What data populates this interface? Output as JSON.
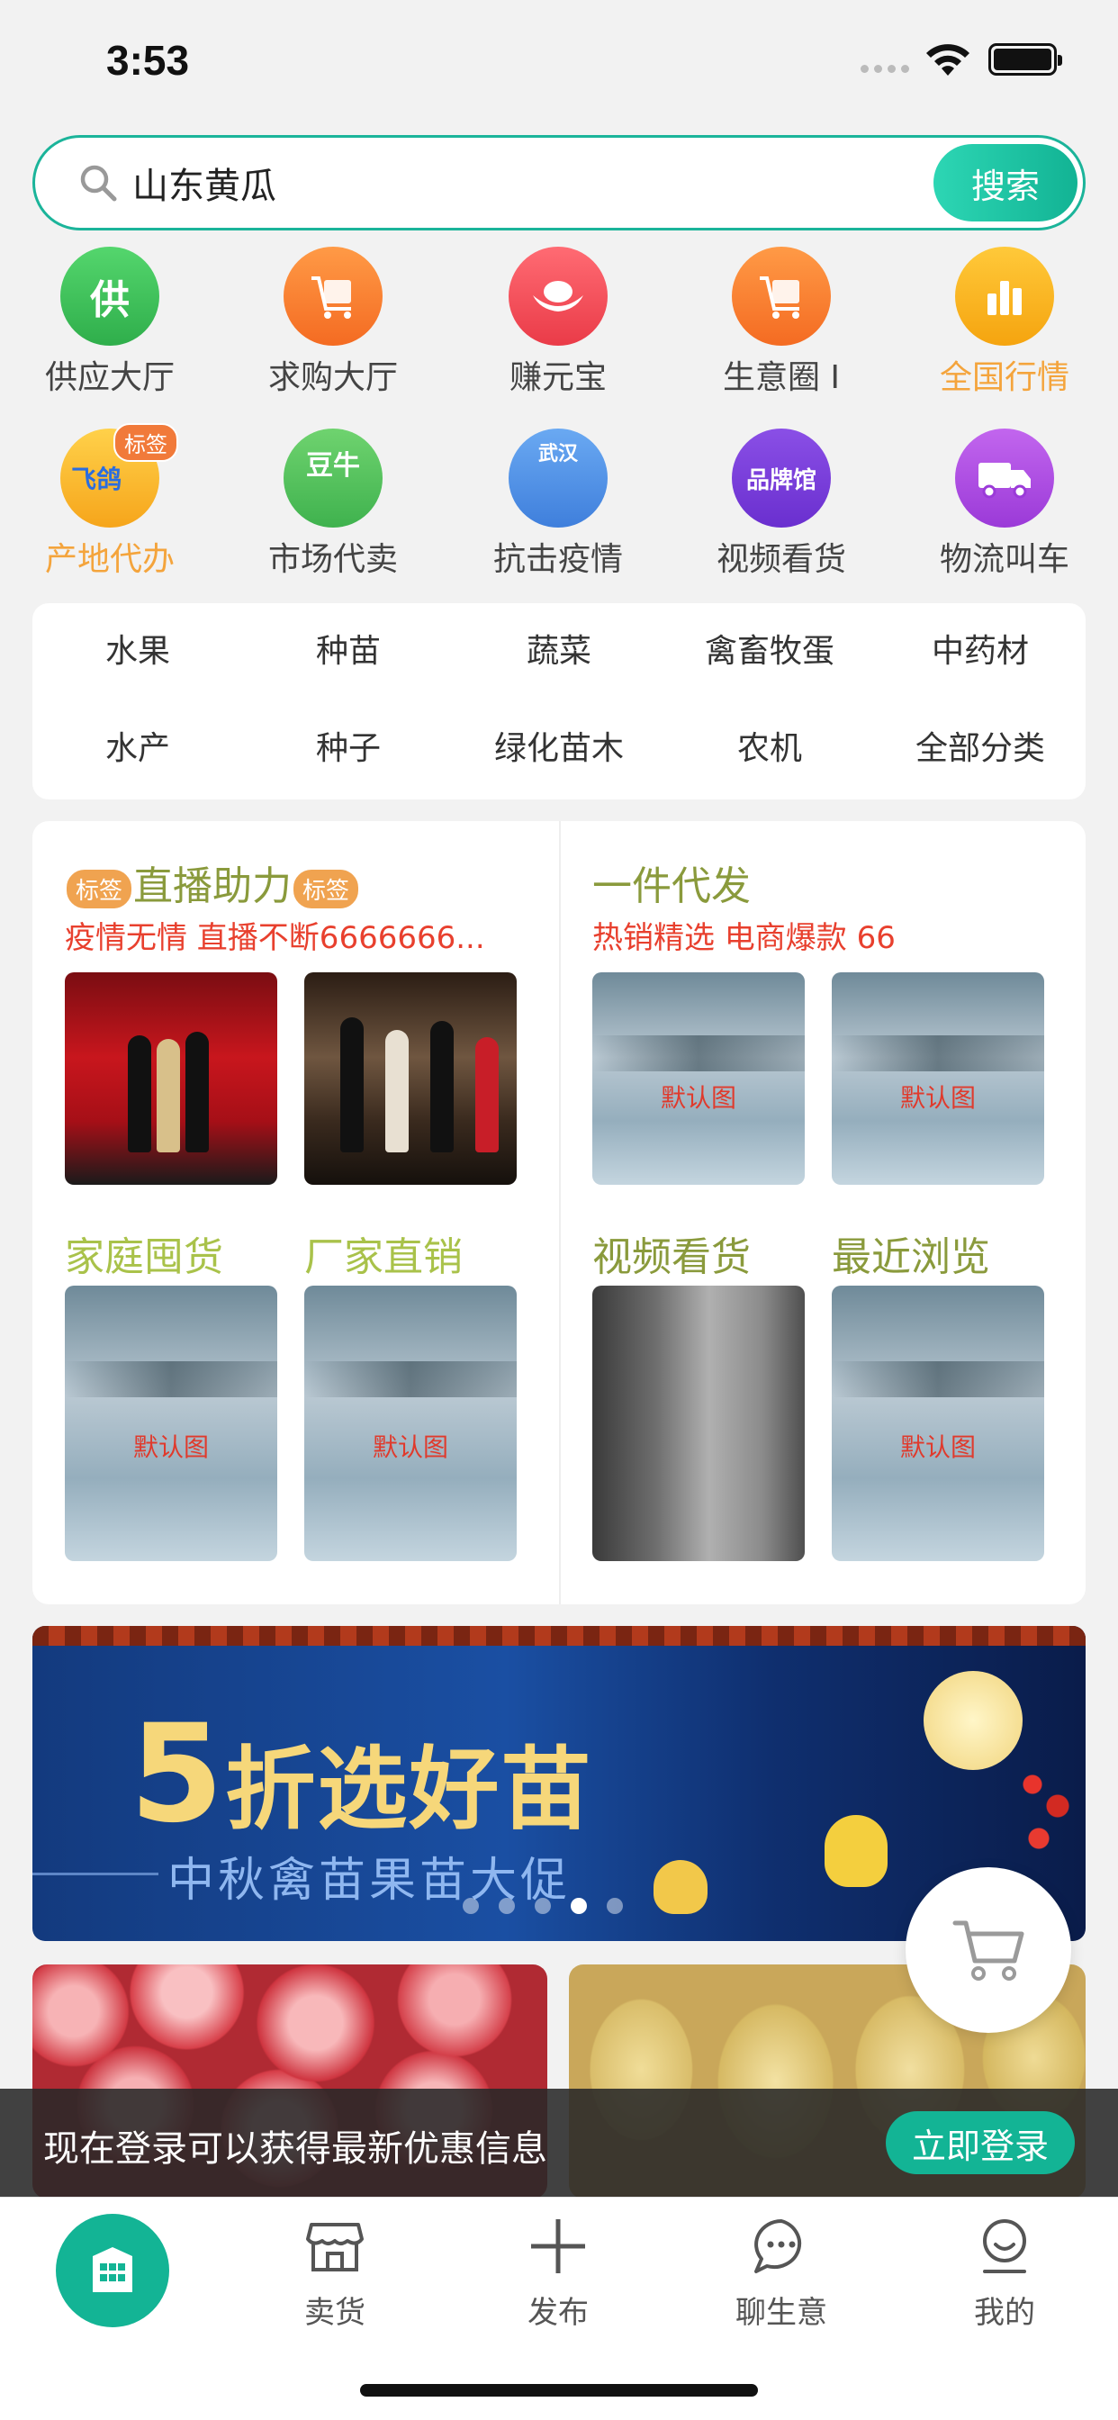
{
  "status_bar": {
    "time": "3:53"
  },
  "search": {
    "value": "山东黄瓜",
    "button_label": "搜索"
  },
  "quick_icons": [
    {
      "label": "供应大厅",
      "glyph": "供",
      "color": "#3fc05c",
      "icon": "supply-hall-icon"
    },
    {
      "label": "求购大厅",
      "glyph": "",
      "color": "#f7832f",
      "icon": "cart-icon"
    },
    {
      "label": "赚元宝",
      "glyph": "",
      "color": "#f0505a",
      "icon": "ingot-icon"
    },
    {
      "label": "生意圈 I",
      "glyph": "",
      "color": "#f7832f",
      "icon": "cart-icon"
    },
    {
      "label": "全国行情",
      "glyph": "",
      "color": "#f6b21e",
      "icon": "bar-chart-icon",
      "highlight": true
    },
    {
      "label": "产地代办",
      "glyph": "飞鸽",
      "color": "#f8b62a",
      "icon": "pigeon-icon",
      "tag": "标签",
      "highlight": true
    },
    {
      "label": "市场代卖",
      "glyph": "豆牛",
      "color": "#57c45e",
      "icon": "cow-icon"
    },
    {
      "label": "抗击疫情",
      "glyph": "武汉",
      "color": "#5a9ae8",
      "icon": "doctor-icon"
    },
    {
      "label": "视频看货",
      "glyph": "品牌馆",
      "color": "#7a3fd8",
      "icon": "brand-hall-icon"
    },
    {
      "label": "物流叫车",
      "glyph": "",
      "color": "#b04fe0",
      "icon": "truck-icon"
    }
  ],
  "categories": [
    "水果",
    "种苗",
    "蔬菜",
    "禽畜牧蛋",
    "中药材",
    "水产",
    "种子",
    "绿化苗木",
    "农机",
    "全部分类"
  ],
  "features": {
    "live": {
      "tag_left": "标签",
      "title": "直播助力",
      "tag_right": "标签",
      "subtitle": "疫情无情 直播不断6666666..."
    },
    "dropship": {
      "title": "一件代发",
      "subtitle": "热销精选 电商爆款 66"
    },
    "family": {
      "title": "家庭囤货"
    },
    "factory": {
      "title": "厂家直销"
    },
    "video": {
      "title": "视频看货"
    },
    "recent": {
      "title": "最近浏览"
    },
    "default_image_label": "默认图"
  },
  "banner": {
    "title_number": "5",
    "title_text": "折选好苗",
    "subtitle": "中秋禽苗果苗大促",
    "slide_count": 5,
    "active_slide": 4
  },
  "login_prompt": {
    "text": "现在登录可以获得最新优惠信息",
    "button_label": "立即登录"
  },
  "tab_bar": [
    {
      "label": "",
      "icon": "home-store-icon",
      "active": true
    },
    {
      "label": "卖货",
      "icon": "shop-icon"
    },
    {
      "label": "发布",
      "icon": "plus-icon"
    },
    {
      "label": "聊生意",
      "icon": "chat-icon"
    },
    {
      "label": "我的",
      "icon": "profile-icon"
    }
  ],
  "colors": {
    "accent": "#13b495",
    "orange": "#f4a43c",
    "red_text": "#e8402e",
    "olive_title": "#8a9a3c"
  }
}
